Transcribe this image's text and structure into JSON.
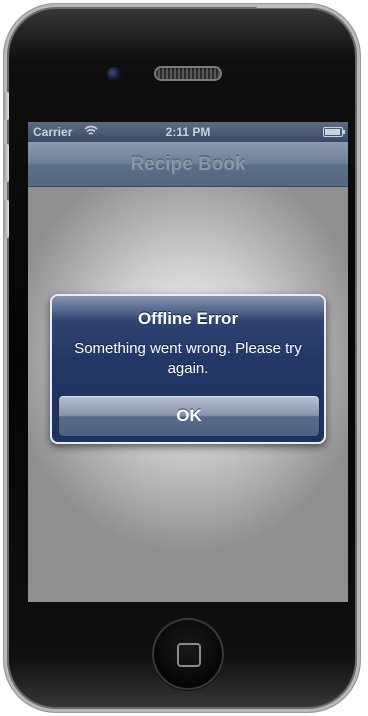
{
  "status_bar": {
    "carrier": "Carrier",
    "time": "2:11 PM",
    "wifi_icon": "wifi-icon",
    "battery_icon": "battery-icon"
  },
  "nav_bar": {
    "title": "Recipe Book"
  },
  "alert": {
    "title": "Offline Error",
    "message": "Something went wrong. Please try again.",
    "button_label": "OK"
  },
  "colors": {
    "alert_background": "#233766",
    "nav_bar": "#6d7f99",
    "status_bar": "#3a4a66"
  }
}
